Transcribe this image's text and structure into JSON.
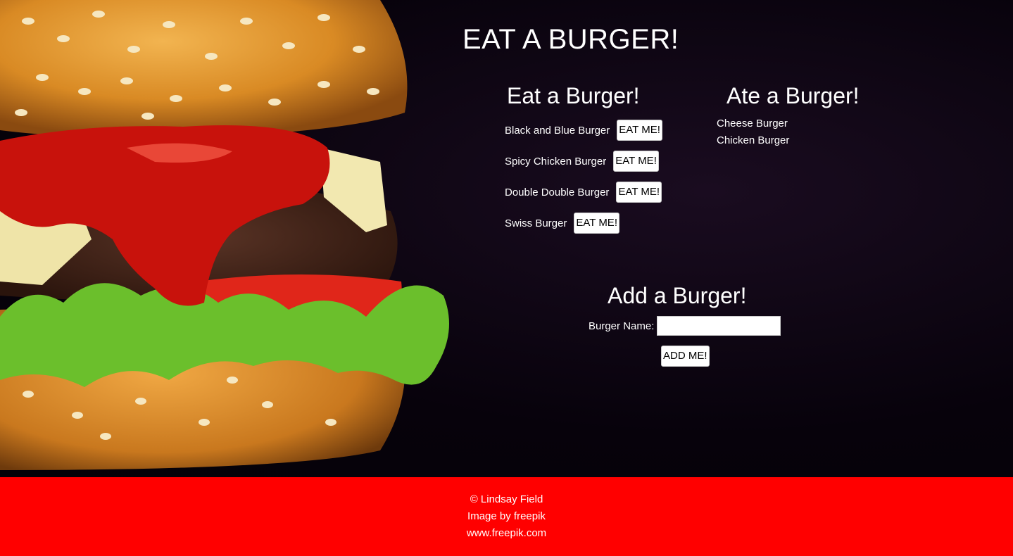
{
  "page": {
    "title": "EAT A BURGER!"
  },
  "eat_section": {
    "heading": "Eat a Burger!",
    "button_label": "EAT ME!",
    "items": [
      {
        "name": "Black and Blue Burger",
        "button": "EAT ME!"
      },
      {
        "name": "Spicy Chicken Burger",
        "button": "EAT ME!"
      },
      {
        "name": "Double Double Burger",
        "button": "EAT ME!"
      },
      {
        "name": "Swiss Burger",
        "button": "EAT ME!"
      }
    ]
  },
  "ate_section": {
    "heading": "Ate a Burger!",
    "items": [
      "Cheese Burger",
      "Chicken Burger"
    ]
  },
  "add_section": {
    "heading": "Add a Burger!",
    "field_label": "Burger Name:",
    "field_value": "",
    "field_placeholder": "",
    "button_label": "ADD ME!"
  },
  "footer": {
    "lines": [
      "© Lindsay Field",
      "Image by freepik",
      "www.freepik.com"
    ]
  },
  "colors": {
    "footer_bg": "#ff0000",
    "hero_bg": "#07020b",
    "text": "#ffffff",
    "button_bg": "#ffffff"
  },
  "icons": {
    "hero_image": "burger-photo"
  }
}
